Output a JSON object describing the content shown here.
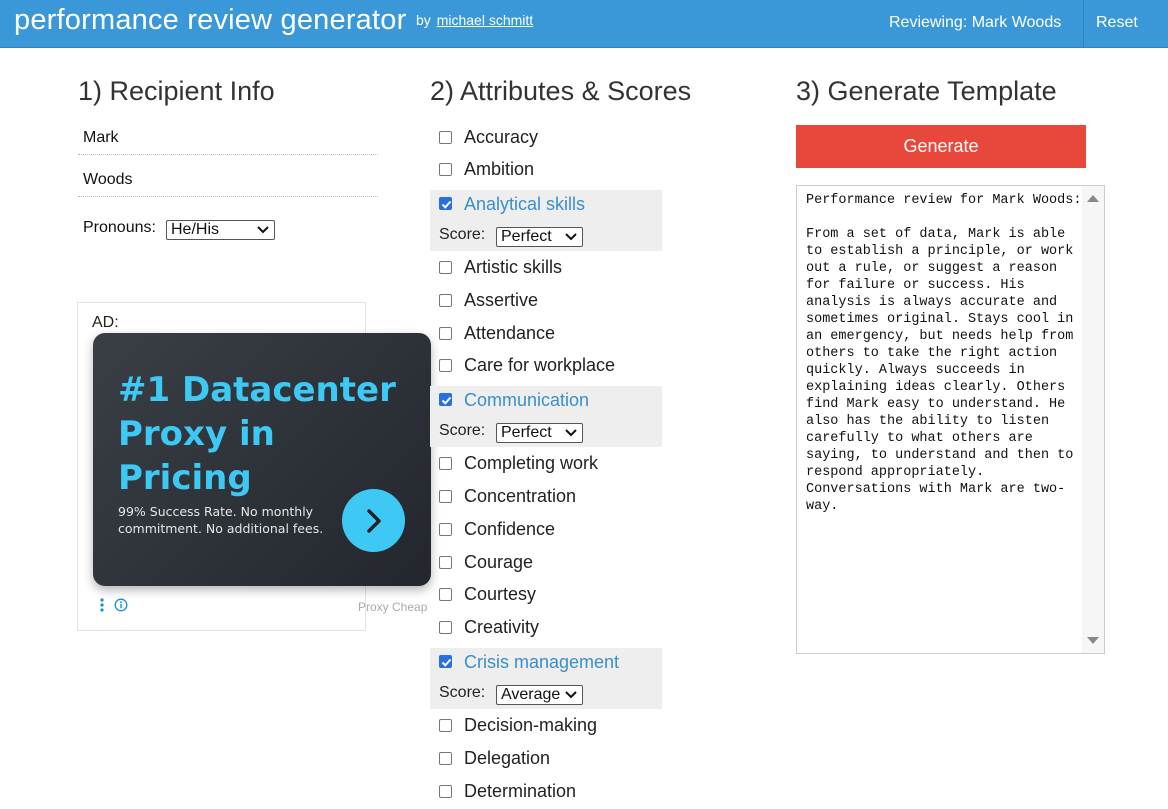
{
  "header": {
    "title": "performance review generator",
    "by": "by",
    "author": "michael schmitt",
    "reviewing": "Reviewing: Mark Woods",
    "reset": "Reset"
  },
  "recipient": {
    "heading": "1) Recipient Info",
    "first_name": "Mark",
    "last_name": "Woods",
    "pronouns_label": "Pronouns:",
    "pronouns_value": "He/His"
  },
  "ad": {
    "label": "AD:",
    "headline": "#1 Datacenter Proxy in Pricing",
    "sub": "99% Success Rate. No monthly commitment. No additional fees.",
    "brand": "Proxy Cheap"
  },
  "attributes": {
    "heading": "2) Attributes & Scores",
    "score_label": "Score:",
    "items": [
      {
        "label": "Accuracy",
        "checked": false
      },
      {
        "label": "Ambition",
        "checked": false
      },
      {
        "label": "Analytical skills",
        "checked": true,
        "score": "Perfect"
      },
      {
        "label": "Artistic skills",
        "checked": false
      },
      {
        "label": "Assertive",
        "checked": false
      },
      {
        "label": "Attendance",
        "checked": false
      },
      {
        "label": "Care for workplace",
        "checked": false
      },
      {
        "label": "Communication",
        "checked": true,
        "score": "Perfect"
      },
      {
        "label": "Completing work",
        "checked": false
      },
      {
        "label": "Concentration",
        "checked": false
      },
      {
        "label": "Confidence",
        "checked": false
      },
      {
        "label": "Courage",
        "checked": false
      },
      {
        "label": "Courtesy",
        "checked": false
      },
      {
        "label": "Creativity",
        "checked": false
      },
      {
        "label": "Crisis management",
        "checked": true,
        "score": "Average"
      },
      {
        "label": "Decision-making",
        "checked": false
      },
      {
        "label": "Delegation",
        "checked": false
      },
      {
        "label": "Determination",
        "checked": false
      }
    ]
  },
  "template": {
    "heading": "3) Generate Template",
    "generate": "Generate",
    "output": "Performance review for Mark Woods:\n\nFrom a set of data, Mark is able to establish a principle, or work out a rule, or suggest a reason for failure or success. His analysis is always accurate and sometimes original. Stays cool in an emergency, but needs help from others to take the right action quickly. Always succeeds in explaining ideas clearly. Others find Mark easy to understand. He also has the ability to listen carefully to what others are saying, to understand and then to respond appropriately. Conversations with Mark are two-way."
  },
  "colors": {
    "header": "#3a98d8",
    "generate": "#e8483b",
    "checked_label": "#3a8fcb",
    "ad_accent": "#3ec9f5"
  }
}
